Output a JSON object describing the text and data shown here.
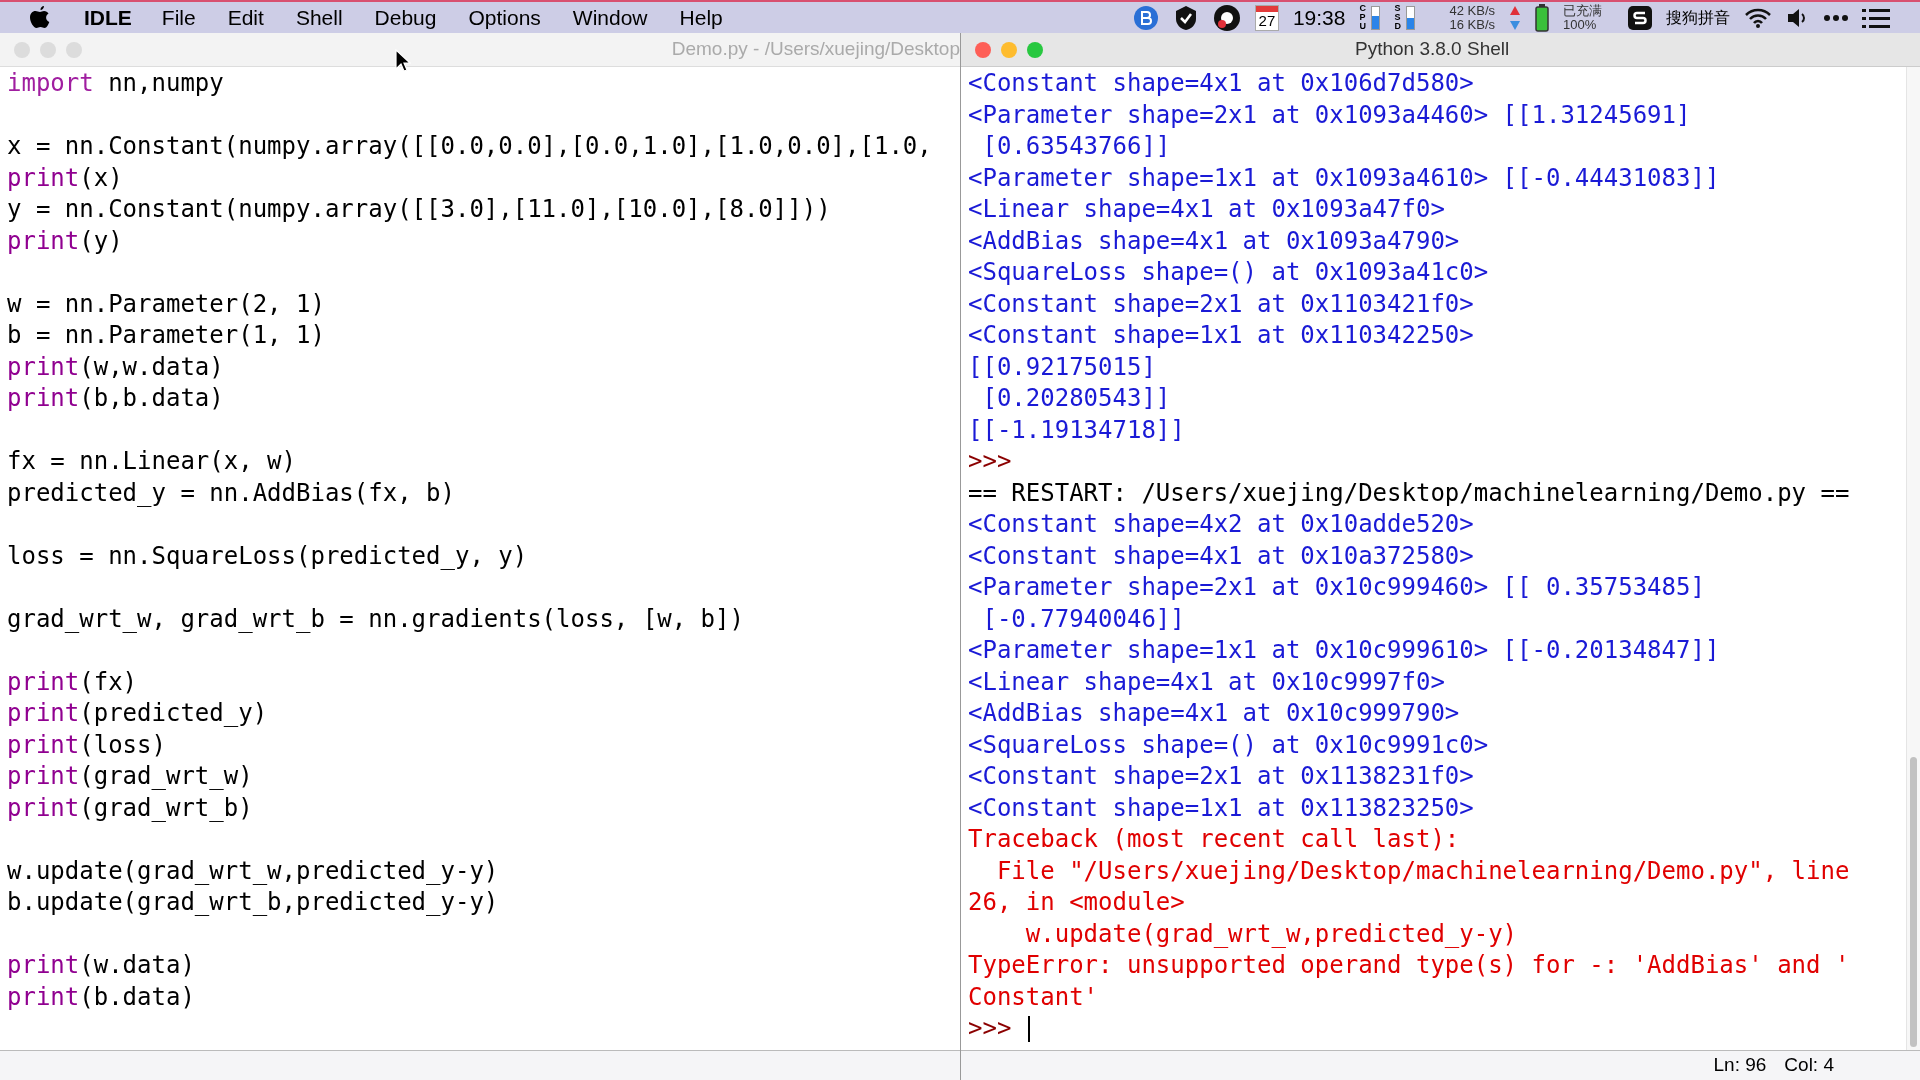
{
  "menu_bar": {
    "app": "IDLE",
    "items": [
      "File",
      "Edit",
      "Shell",
      "Debug",
      "Options",
      "Window",
      "Help"
    ],
    "tray": {
      "date": "27",
      "time": "19:38",
      "cpu": {
        "label": "CPU",
        "level": 0.55
      },
      "ssd": {
        "label": "SSD",
        "level": 0.5
      },
      "upload": "42 KB/s",
      "download": "16 KB/s",
      "battery_status": "已充满",
      "battery_percent": "100%",
      "ime": "搜狗拼音"
    }
  },
  "editor": {
    "title": "Demo.py - /Users/xuejing/Desktop",
    "active": false,
    "lines": [
      {
        "kind": "code",
        "segments": [
          {
            "kind": "keyword",
            "text": "import"
          },
          {
            "kind": "plain",
            "text": " nn,numpy"
          }
        ]
      },
      {
        "kind": "blank"
      },
      {
        "kind": "code",
        "segments": [
          {
            "kind": "plain",
            "text": "x = nn.Constant(numpy.array([[0.0,0.0],[0.0,1.0],[1.0,0.0],[1.0,"
          }
        ]
      },
      {
        "kind": "code",
        "segments": [
          {
            "kind": "builtin",
            "text": "print"
          },
          {
            "kind": "plain",
            "text": "(x)"
          }
        ]
      },
      {
        "kind": "code",
        "segments": [
          {
            "kind": "plain",
            "text": "y = nn.Constant(numpy.array([[3.0],[11.0],[10.0],[8.0]]))"
          }
        ]
      },
      {
        "kind": "code",
        "segments": [
          {
            "kind": "builtin",
            "text": "print"
          },
          {
            "kind": "plain",
            "text": "(y)"
          }
        ]
      },
      {
        "kind": "blank"
      },
      {
        "kind": "code",
        "segments": [
          {
            "kind": "plain",
            "text": "w = nn.Parameter(2, 1)"
          }
        ]
      },
      {
        "kind": "code",
        "segments": [
          {
            "kind": "plain",
            "text": "b = nn.Parameter(1, 1)"
          }
        ]
      },
      {
        "kind": "code",
        "segments": [
          {
            "kind": "builtin",
            "text": "print"
          },
          {
            "kind": "plain",
            "text": "(w,w.data)"
          }
        ]
      },
      {
        "kind": "code",
        "segments": [
          {
            "kind": "builtin",
            "text": "print"
          },
          {
            "kind": "plain",
            "text": "(b,b.data)"
          }
        ]
      },
      {
        "kind": "blank"
      },
      {
        "kind": "code",
        "segments": [
          {
            "kind": "plain",
            "text": "fx = nn.Linear(x, w)"
          }
        ]
      },
      {
        "kind": "code",
        "segments": [
          {
            "kind": "plain",
            "text": "predicted_y = nn.AddBias(fx, b)"
          }
        ]
      },
      {
        "kind": "blank"
      },
      {
        "kind": "code",
        "segments": [
          {
            "kind": "plain",
            "text": "loss = nn.SquareLoss(predicted_y, y)"
          }
        ]
      },
      {
        "kind": "blank"
      },
      {
        "kind": "code",
        "segments": [
          {
            "kind": "plain",
            "text": "grad_wrt_w, grad_wrt_b = nn.gradients(loss, [w, b])"
          }
        ]
      },
      {
        "kind": "blank"
      },
      {
        "kind": "code",
        "segments": [
          {
            "kind": "builtin",
            "text": "print"
          },
          {
            "kind": "plain",
            "text": "(fx)"
          }
        ]
      },
      {
        "kind": "code",
        "segments": [
          {
            "kind": "builtin",
            "text": "print"
          },
          {
            "kind": "plain",
            "text": "(predicted_y)"
          }
        ]
      },
      {
        "kind": "code",
        "segments": [
          {
            "kind": "builtin",
            "text": "print"
          },
          {
            "kind": "plain",
            "text": "(loss)"
          }
        ]
      },
      {
        "kind": "code",
        "segments": [
          {
            "kind": "builtin",
            "text": "print"
          },
          {
            "kind": "plain",
            "text": "(grad_wrt_w)"
          }
        ]
      },
      {
        "kind": "code",
        "segments": [
          {
            "kind": "builtin",
            "text": "print"
          },
          {
            "kind": "plain",
            "text": "(grad_wrt_b)"
          }
        ]
      },
      {
        "kind": "blank"
      },
      {
        "kind": "code",
        "segments": [
          {
            "kind": "plain",
            "text": "w.update(grad_wrt_w,predicted_y-y)"
          }
        ]
      },
      {
        "kind": "code",
        "segments": [
          {
            "kind": "plain",
            "text": "b.update(grad_wrt_b,predicted_y-y)"
          }
        ]
      },
      {
        "kind": "blank"
      },
      {
        "kind": "code",
        "segments": [
          {
            "kind": "builtin",
            "text": "print"
          },
          {
            "kind": "plain",
            "text": "(w.data)"
          }
        ]
      },
      {
        "kind": "code",
        "segments": [
          {
            "kind": "builtin",
            "text": "print"
          },
          {
            "kind": "plain",
            "text": "(b.data)"
          }
        ]
      }
    ]
  },
  "shell": {
    "title": "Python 3.8.0 Shell",
    "active": true,
    "lines": [
      {
        "kind": "output",
        "text": "<Constant shape=4x1 at 0x106d7d580>"
      },
      {
        "kind": "output",
        "text": "<Parameter shape=2x1 at 0x1093a4460> [[1.31245691]"
      },
      {
        "kind": "output",
        "text": " [0.63543766]]"
      },
      {
        "kind": "output",
        "text": "<Parameter shape=1x1 at 0x1093a4610> [[-0.44431083]]"
      },
      {
        "kind": "output",
        "text": "<Linear shape=4x1 at 0x1093a47f0>"
      },
      {
        "kind": "output",
        "text": "<AddBias shape=4x1 at 0x1093a4790>"
      },
      {
        "kind": "output",
        "text": "<SquareLoss shape=() at 0x1093a41c0>"
      },
      {
        "kind": "output",
        "text": "<Constant shape=2x1 at 0x1103421f0>"
      },
      {
        "kind": "output",
        "text": "<Constant shape=1x1 at 0x110342250>"
      },
      {
        "kind": "output",
        "text": "[[0.92175015]"
      },
      {
        "kind": "output",
        "text": " [0.20280543]]"
      },
      {
        "kind": "output",
        "text": "[[-1.19134718]]"
      },
      {
        "kind": "prompt",
        "text": ">>>"
      },
      {
        "kind": "restart",
        "text": "== RESTART: /Users/xuejing/Desktop/machinelearning/Demo.py =="
      },
      {
        "kind": "output",
        "text": "<Constant shape=4x2 at 0x10adde520>"
      },
      {
        "kind": "output",
        "text": "<Constant shape=4x1 at 0x10a372580>"
      },
      {
        "kind": "output",
        "text": "<Parameter shape=2x1 at 0x10c999460> [[ 0.35753485]"
      },
      {
        "kind": "output",
        "text": " [-0.77940046]]"
      },
      {
        "kind": "output",
        "text": "<Parameter shape=1x1 at 0x10c999610> [[-0.20134847]]"
      },
      {
        "kind": "output",
        "text": "<Linear shape=4x1 at 0x10c9997f0>"
      },
      {
        "kind": "output",
        "text": "<AddBias shape=4x1 at 0x10c999790>"
      },
      {
        "kind": "output",
        "text": "<SquareLoss shape=() at 0x10c9991c0>"
      },
      {
        "kind": "output",
        "text": "<Constant shape=2x1 at 0x1138231f0>"
      },
      {
        "kind": "output",
        "text": "<Constant shape=1x1 at 0x113823250>"
      },
      {
        "kind": "error",
        "text": "Traceback (most recent call last):"
      },
      {
        "kind": "error",
        "text": "  File \"/Users/xuejing/Desktop/machinelearning/Demo.py\", line"
      },
      {
        "kind": "error",
        "text": "26, in <module>"
      },
      {
        "kind": "error",
        "text": "    w.update(grad_wrt_w,predicted_y-y)"
      },
      {
        "kind": "error",
        "text": "TypeError: unsupported operand type(s) for -: 'AddBias' and '"
      },
      {
        "kind": "error",
        "text": "Constant'"
      }
    ],
    "input_prompt": {
      "text": ">>>",
      "cursor": true
    },
    "status": {
      "line": "Ln: 96",
      "col": "Col: 4"
    }
  }
}
